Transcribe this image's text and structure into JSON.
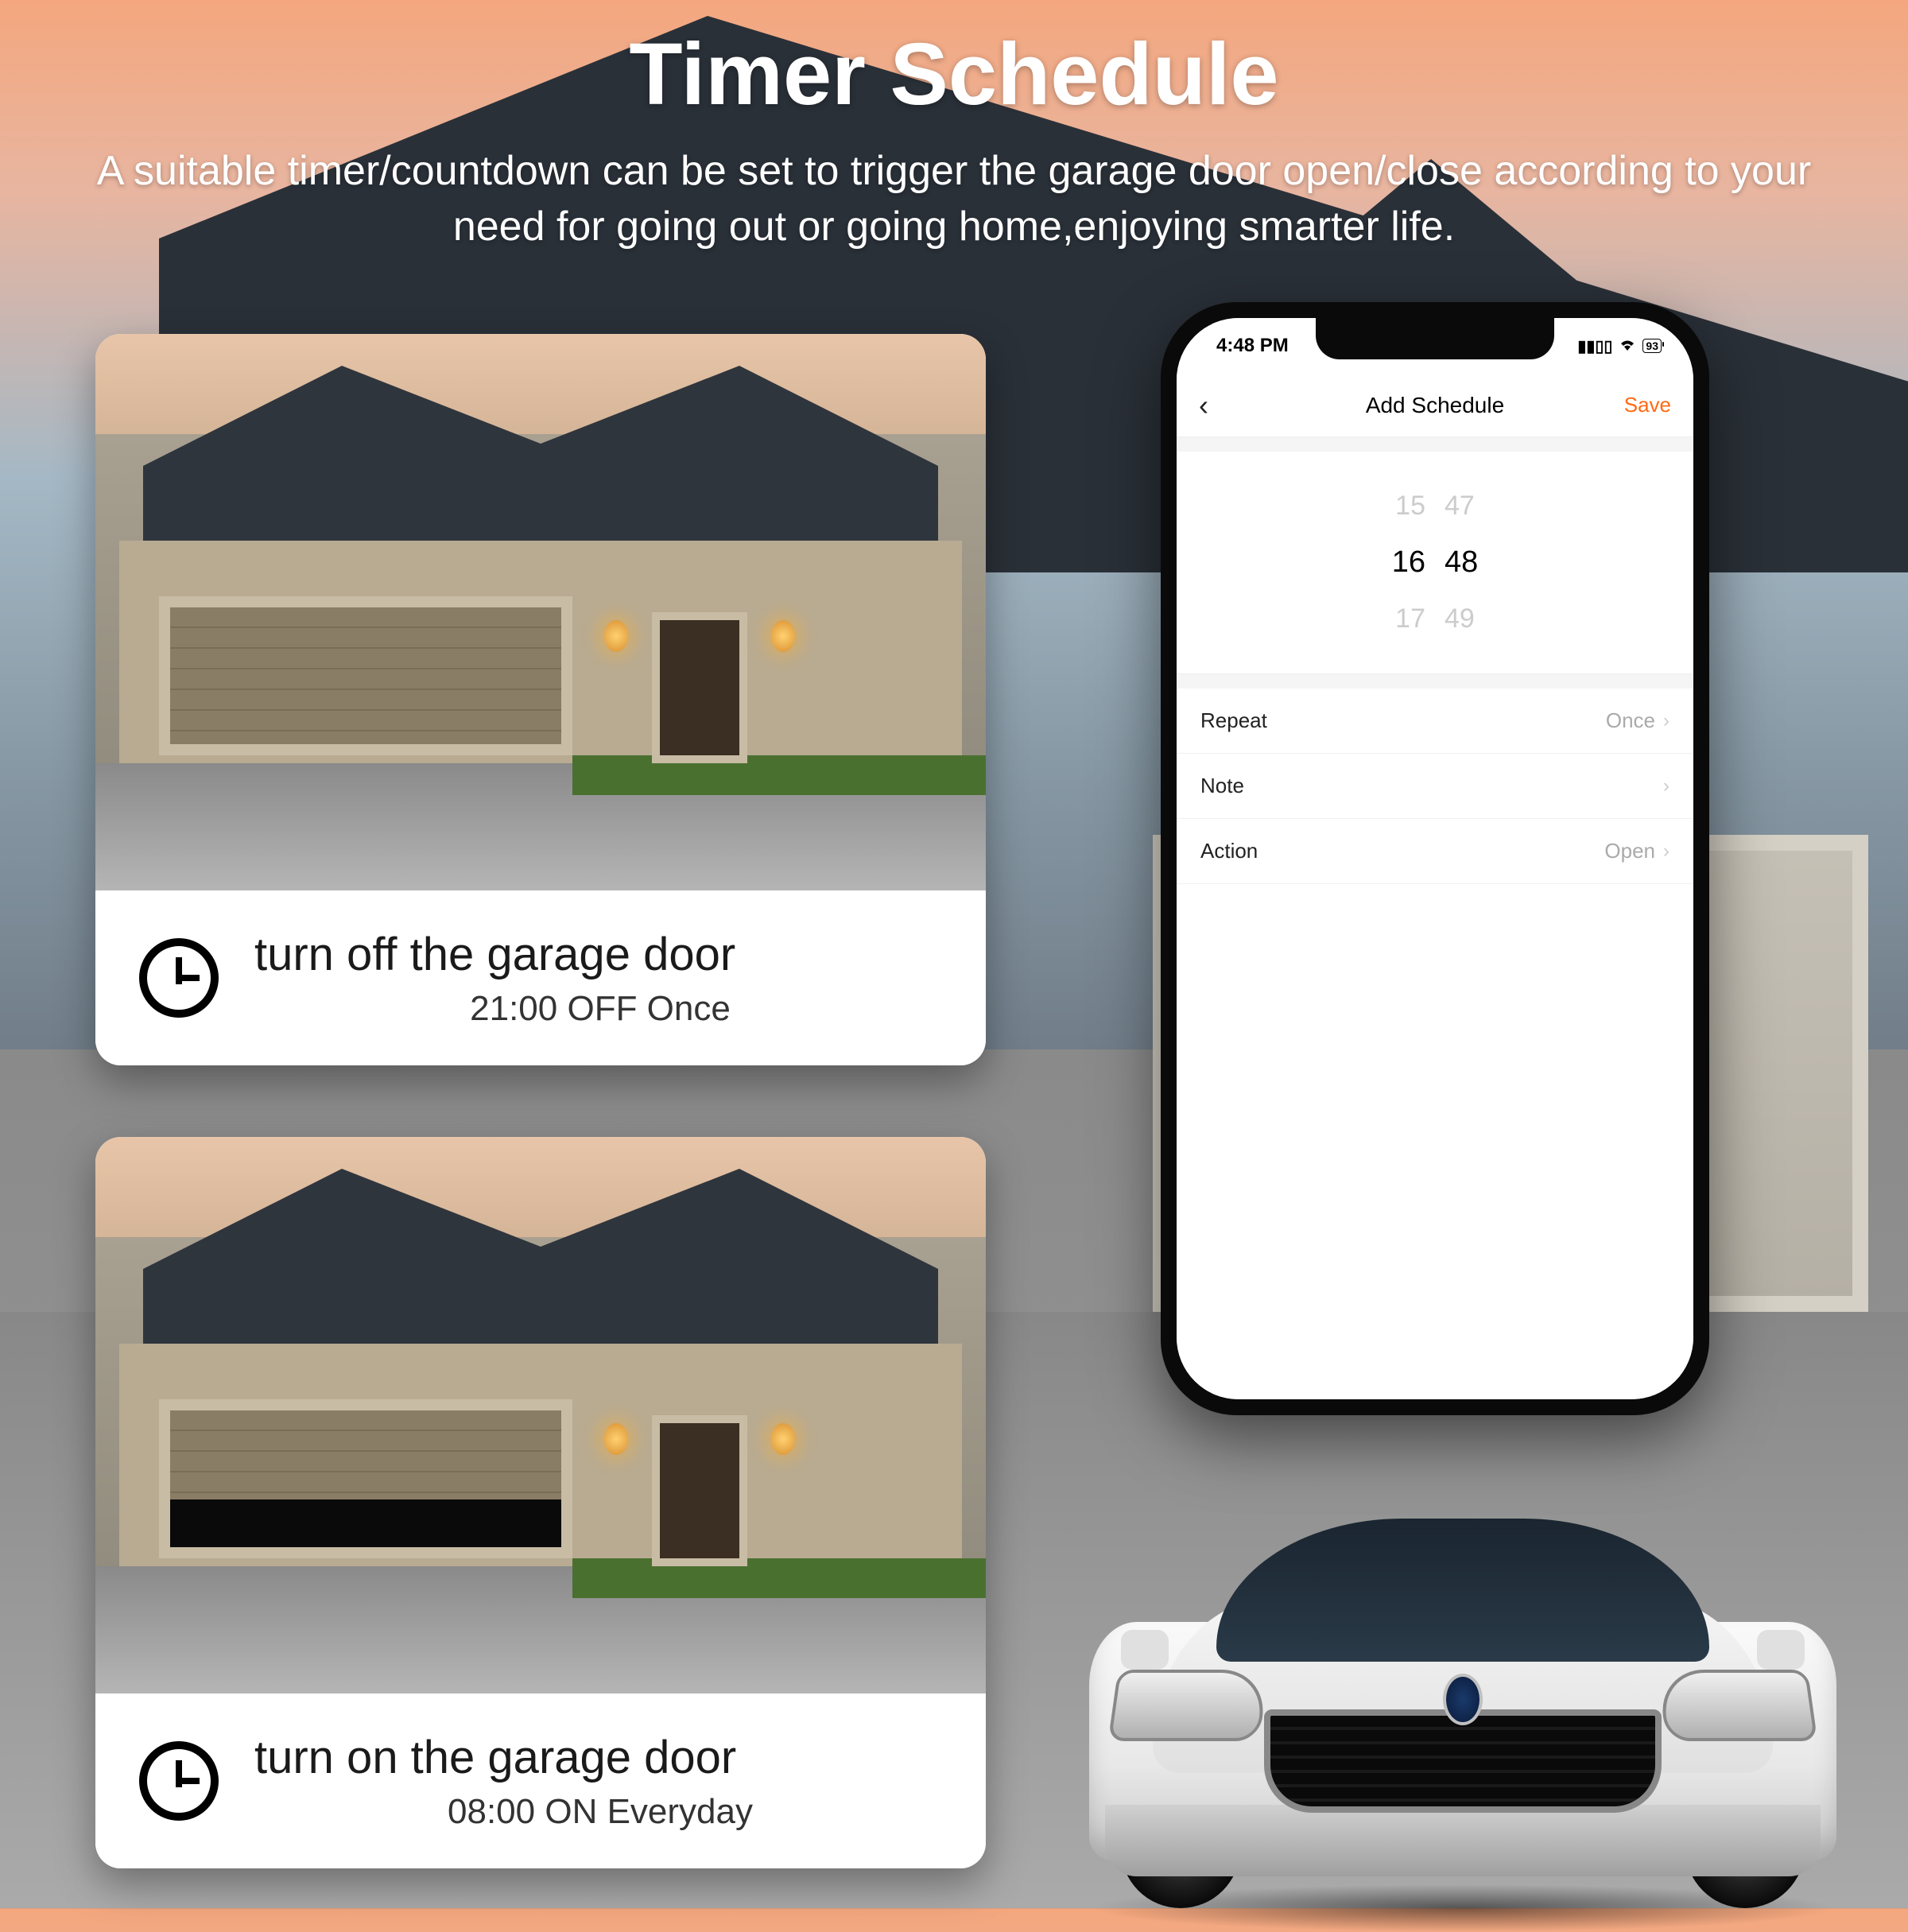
{
  "header": {
    "title": "Timer Schedule",
    "subtitle": "A suitable timer/countdown can be set to trigger the garage door open/close according to your need for going out or going home,enjoying smarter life."
  },
  "cards": [
    {
      "title": "turn off the garage door",
      "detail": "21:00 OFF Once"
    },
    {
      "title": "turn on the garage door",
      "detail": "08:00 ON Everyday"
    }
  ],
  "phone": {
    "status": {
      "time": "4:48 PM",
      "signal": "••ıl",
      "wifi": "􀙇",
      "battery": "93"
    },
    "nav": {
      "back": "‹",
      "title": "Add Schedule",
      "save": "Save"
    },
    "picker": {
      "prev": {
        "h": "15",
        "m": "47"
      },
      "sel": {
        "h": "16",
        "m": "48"
      },
      "next": {
        "h": "17",
        "m": "49"
      }
    },
    "settings": [
      {
        "label": "Repeat",
        "value": "Once"
      },
      {
        "label": "Note",
        "value": ""
      },
      {
        "label": "Action",
        "value": "Open"
      }
    ]
  }
}
